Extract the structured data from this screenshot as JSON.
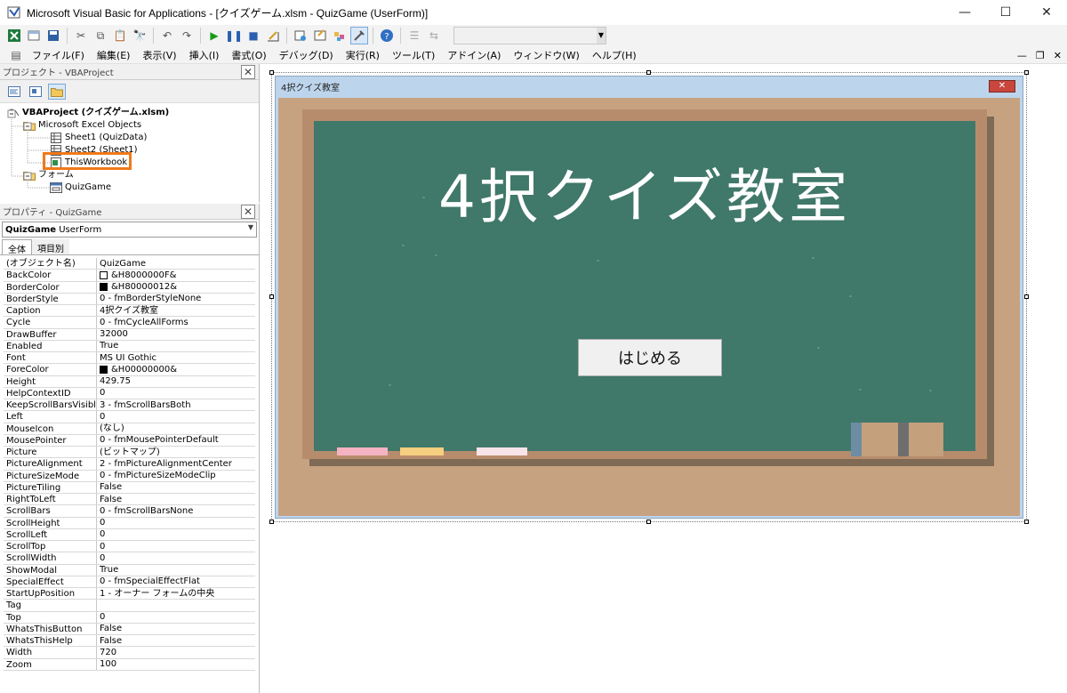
{
  "window": {
    "title": "Microsoft Visual Basic for Applications - [クイズゲーム.xlsm - QuizGame (UserForm)]",
    "controls": {
      "minimize": "—",
      "maximize": "☐",
      "close": "✕"
    }
  },
  "menu": [
    "ファイル(F)",
    "編集(E)",
    "表示(V)",
    "挿入(I)",
    "書式(O)",
    "デバッグ(D)",
    "実行(R)",
    "ツール(T)",
    "アドイン(A)",
    "ウィンドウ(W)",
    "ヘルプ(H)"
  ],
  "mdi_controls": {
    "minimize": "—",
    "restore": "❐",
    "close": "✕"
  },
  "project_panel": {
    "title": "プロジェクト - VBAProject",
    "tree": {
      "root": "VBAProject (クイズゲーム.xlsm)",
      "excel_objects": "Microsoft Excel Objects",
      "sheet1": "Sheet1 (QuizData)",
      "sheet2": "Sheet2 (Sheet1)",
      "workbook": "ThisWorkbook",
      "forms": "フォーム",
      "form": "QuizGame"
    }
  },
  "properties_panel": {
    "title": "プロパティ - QuizGame",
    "object_name": "QuizGame",
    "object_type": "UserForm",
    "tabs": [
      "全体",
      "項目別"
    ],
    "rows": [
      {
        "name": "(オブジェクト名)",
        "value": "QuizGame"
      },
      {
        "name": "BackColor",
        "value": "&H8000000F&",
        "swatch": "#ffffff"
      },
      {
        "name": "BorderColor",
        "value": "&H80000012&",
        "swatch": "#000000"
      },
      {
        "name": "BorderStyle",
        "value": "0 - fmBorderStyleNone"
      },
      {
        "name": "Caption",
        "value": "4択クイズ教室"
      },
      {
        "name": "Cycle",
        "value": "0 - fmCycleAllForms"
      },
      {
        "name": "DrawBuffer",
        "value": "32000"
      },
      {
        "name": "Enabled",
        "value": "True"
      },
      {
        "name": "Font",
        "value": "MS UI Gothic"
      },
      {
        "name": "ForeColor",
        "value": "&H00000000&",
        "swatch": "#000000"
      },
      {
        "name": "Height",
        "value": "429.75"
      },
      {
        "name": "HelpContextID",
        "value": "0"
      },
      {
        "name": "KeepScrollBarsVisible",
        "value": "3 - fmScrollBarsBoth"
      },
      {
        "name": "Left",
        "value": "0"
      },
      {
        "name": "MouseIcon",
        "value": "(なし)"
      },
      {
        "name": "MousePointer",
        "value": "0 - fmMousePointerDefault"
      },
      {
        "name": "Picture",
        "value": "(ビットマップ)"
      },
      {
        "name": "PictureAlignment",
        "value": "2 - fmPictureAlignmentCenter"
      },
      {
        "name": "PictureSizeMode",
        "value": "0 - fmPictureSizeModeClip"
      },
      {
        "name": "PictureTiling",
        "value": "False"
      },
      {
        "name": "RightToLeft",
        "value": "False"
      },
      {
        "name": "ScrollBars",
        "value": "0 - fmScrollBarsNone"
      },
      {
        "name": "ScrollHeight",
        "value": "0"
      },
      {
        "name": "ScrollLeft",
        "value": "0"
      },
      {
        "name": "ScrollTop",
        "value": "0"
      },
      {
        "name": "ScrollWidth",
        "value": "0"
      },
      {
        "name": "ShowModal",
        "value": "True"
      },
      {
        "name": "SpecialEffect",
        "value": "0 - fmSpecialEffectFlat"
      },
      {
        "name": "StartUpPosition",
        "value": "1 - オーナー フォームの中央"
      },
      {
        "name": "Tag",
        "value": ""
      },
      {
        "name": "Top",
        "value": "0"
      },
      {
        "name": "WhatsThisButton",
        "value": "False"
      },
      {
        "name": "WhatsThisHelp",
        "value": "False"
      },
      {
        "name": "Width",
        "value": "720"
      },
      {
        "name": "Zoom",
        "value": "100"
      }
    ]
  },
  "userform": {
    "caption": "4択クイズ教室",
    "close_glyph": "✕",
    "board_title": "4択クイズ教室",
    "start_button": "はじめる"
  },
  "colors": {
    "board": "#407869",
    "board_frame": "#b78c6d",
    "form_background": "#c7a281",
    "highlight_box": "#f07a1a",
    "chalk": [
      "#f4b3c2",
      "#f7cf80",
      "#f8e4e8"
    ],
    "eraser": "#c4a07c"
  }
}
